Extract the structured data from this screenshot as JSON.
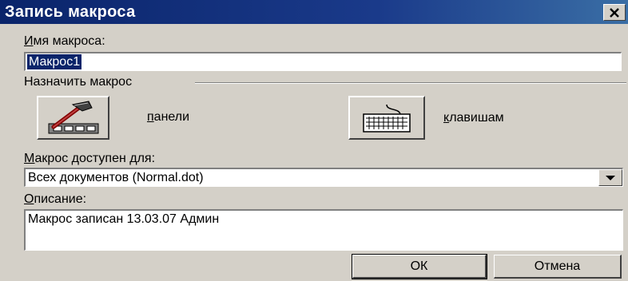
{
  "window": {
    "title": "Запись макроса",
    "close_icon": "close-icon"
  },
  "macro_name": {
    "label_accel": "И",
    "label_rest": "мя макроса:",
    "value": "Макрос1"
  },
  "assign": {
    "group_label": "Назначить макрос",
    "panels": {
      "icon": "hammer-toolbar-icon",
      "label_accel": "п",
      "label_rest": "анели"
    },
    "keys": {
      "icon": "keyboard-icon",
      "label_accel": "к",
      "label_rest": "лавишам"
    }
  },
  "store_in": {
    "label_accel": "М",
    "label_rest": "акрос доступен для:",
    "selected": "Всех документов (Normal.dot)",
    "arrow_icon": "dropdown-arrow-icon"
  },
  "description": {
    "label_accel": "О",
    "label_rest": "писание:",
    "value": "Макрос записан 13.03.07 Админ"
  },
  "buttons": {
    "ok": "ОК",
    "cancel": "Отмена"
  },
  "colors": {
    "titlebar": "#0a246a",
    "face": "#d4d0c8"
  }
}
